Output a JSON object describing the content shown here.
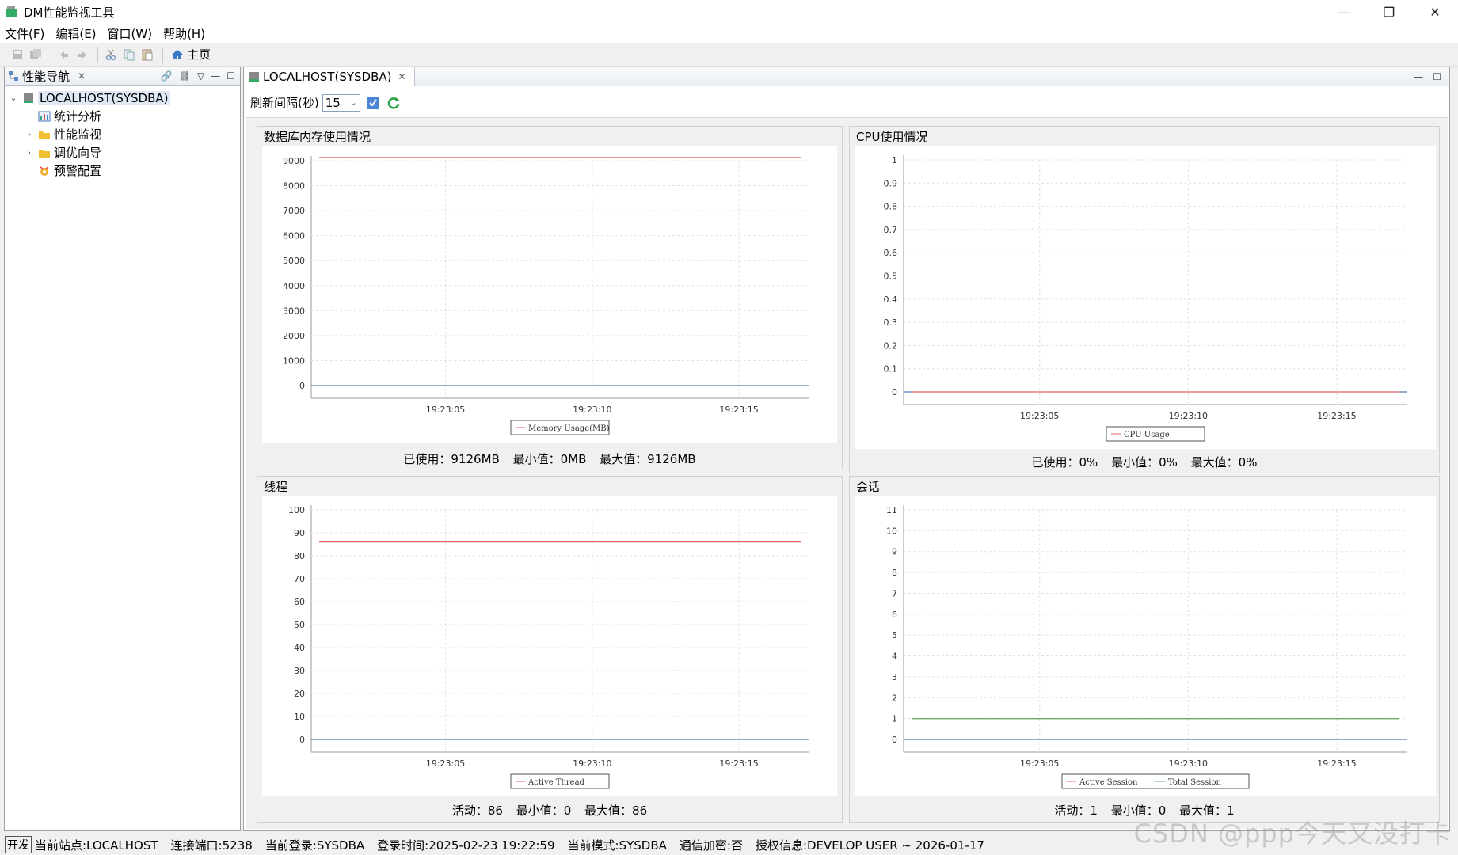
{
  "window": {
    "title": "DM性能监视工具",
    "minimize": "—",
    "restore": "❐",
    "close": "✕"
  },
  "menu": [
    "文件(F)",
    "编辑(E)",
    "窗口(W)",
    "帮助(H)"
  ],
  "toolbar": {
    "home_label": "主页"
  },
  "nav": {
    "tab_label": "性能导航",
    "root_label": "LOCALHOST(SYSDBA)",
    "items": [
      {
        "label": "统计分析",
        "icon": "chart-icon"
      },
      {
        "label": "性能监视",
        "icon": "folder-icon"
      },
      {
        "label": "调优向导",
        "icon": "folder-icon"
      },
      {
        "label": "预警配置",
        "icon": "alert-config-icon"
      }
    ]
  },
  "editor": {
    "tab_label": "LOCALHOST(SYSDBA)",
    "refresh_label": "刷新间隔(秒)",
    "refresh_value": "15"
  },
  "charts": {
    "memory": {
      "title": "数据库内存使用情况",
      "stats": {
        "used": "已使用：9126MB",
        "min": "最小值：0MB",
        "max": "最大值：9126MB"
      }
    },
    "cpu": {
      "title": "CPU使用情况",
      "stats": {
        "used": "已使用：0%",
        "min": "最小值：0%",
        "max": "最大值：0%"
      }
    },
    "thread": {
      "title": "线程",
      "stats": {
        "active": "活动：86",
        "min": "最小值：0",
        "max": "最大值：86"
      }
    },
    "session": {
      "title": "会话",
      "stats": {
        "active": "活动：1",
        "min": "最小值：0",
        "max": "最大值：1"
      }
    }
  },
  "chart_data": [
    {
      "id": "memory",
      "type": "line",
      "x": [
        "19:23:05",
        "19:23:10",
        "19:23:15"
      ],
      "ylim": [
        0,
        9000
      ],
      "yticks": [
        0,
        1000,
        2000,
        3000,
        4000,
        5000,
        6000,
        7000,
        8000,
        9000
      ],
      "series": [
        {
          "name": "Memory Usage(MB)",
          "values": [
            9126,
            9126,
            9126
          ],
          "color": "#e06060"
        }
      ],
      "grid": true,
      "legend": "bottom"
    },
    {
      "id": "cpu",
      "type": "line",
      "x": [
        "19:23:05",
        "19:23:10",
        "19:23:15"
      ],
      "ylim": [
        0,
        1
      ],
      "yticks": [
        "0",
        "0.1",
        "0.2",
        "0.3",
        "0.4",
        "0.5",
        "0.6",
        "0.7",
        "0.8",
        "0.9",
        "1"
      ],
      "series": [
        {
          "name": "CPU Usage",
          "values": [
            0,
            0,
            0
          ],
          "color": "#e06060"
        }
      ],
      "grid": true,
      "legend": "bottom"
    },
    {
      "id": "thread",
      "type": "line",
      "x": [
        "19:23:05",
        "19:23:10",
        "19:23:15"
      ],
      "ylim": [
        0,
        100
      ],
      "yticks": [
        0,
        10,
        20,
        30,
        40,
        50,
        60,
        70,
        80,
        90,
        100
      ],
      "series": [
        {
          "name": "Active Thread",
          "values": [
            86,
            86,
            86
          ],
          "color": "#e06060"
        }
      ],
      "grid": true,
      "legend": "bottom"
    },
    {
      "id": "session",
      "type": "line",
      "x": [
        "19:23:05",
        "19:23:10",
        "19:23:15"
      ],
      "ylim": [
        0,
        11
      ],
      "yticks": [
        0,
        1,
        2,
        3,
        4,
        5,
        6,
        7,
        8,
        9,
        10,
        11
      ],
      "series": [
        {
          "name": "Active Session",
          "values": [
            1,
            1,
            1
          ],
          "color": "#e06060"
        },
        {
          "name": "Total Session",
          "values": [
            1,
            1,
            1
          ],
          "color": "#60b060"
        }
      ],
      "grid": true,
      "legend": "bottom"
    }
  ],
  "status": {
    "badge": "开发",
    "site": "当前站点:LOCALHOST",
    "port": "连接端口:5238",
    "login": "当前登录:SYSDBA",
    "time": "登录时间:2025-02-23 19:22:59",
    "mode": "当前模式:SYSDBA",
    "encrypt": "通信加密:否",
    "license": "授权信息:DEVELOP USER ~ 2026-01-17"
  },
  "watermark": "CSDN @ppp今天又没打卡"
}
